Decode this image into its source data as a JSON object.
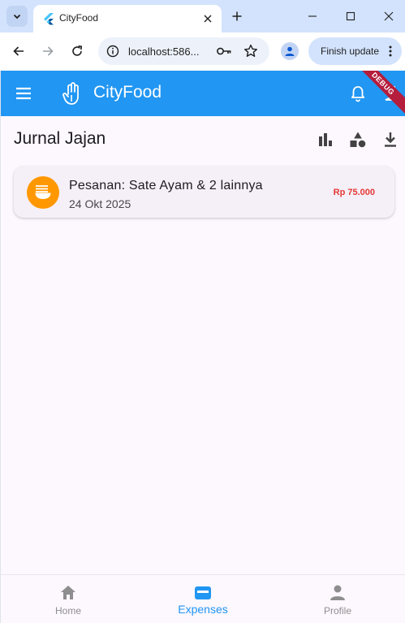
{
  "browser": {
    "tab_title": "CityFood",
    "url": "localhost:586...",
    "update_button": "Finish update"
  },
  "app": {
    "brand": "CityFood",
    "debug_banner": "DEBUG",
    "page_title": "Jurnal Jajan",
    "orders": [
      {
        "title": "Pesanan: Sate Ayam & 2 lainnya",
        "date": "24 Okt 2025",
        "amount": "Rp 75.000",
        "icon": "ramen-icon"
      }
    ],
    "nav": [
      {
        "label": "Home",
        "icon": "home-icon",
        "active": false
      },
      {
        "label": "Expenses",
        "icon": "wallet-icon",
        "active": true
      },
      {
        "label": "Profile",
        "icon": "person-icon",
        "active": false
      }
    ]
  },
  "colors": {
    "primary": "#2196f3",
    "accent_orange": "#ff9800",
    "amount_red": "#e53935",
    "background": "#fdf7fe"
  }
}
